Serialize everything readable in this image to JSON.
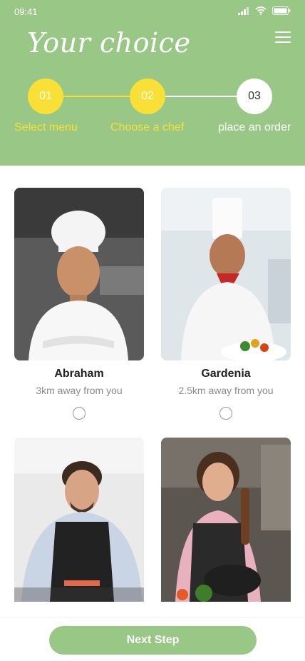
{
  "status_bar": {
    "time": "09:41",
    "icons": [
      "signal-icon",
      "wifi-icon",
      "battery-icon"
    ]
  },
  "header": {
    "title": "Your choice",
    "menu_icon": "hamburger-menu-icon"
  },
  "steps": [
    {
      "number": "01",
      "label": "Select menu",
      "state": "done"
    },
    {
      "number": "02",
      "label": "Choose a chef",
      "state": "current"
    },
    {
      "number": "03",
      "label": "place an order",
      "state": "pending"
    }
  ],
  "chefs": [
    {
      "name": "Abraham",
      "distance": "3km away from you",
      "selected": false
    },
    {
      "name": "Gardenia",
      "distance": "2.5km away from you",
      "selected": false
    },
    {
      "name": "",
      "distance": "",
      "selected": false
    },
    {
      "name": "",
      "distance": "",
      "selected": false
    }
  ],
  "footer": {
    "next_label": "Next Step"
  },
  "colors": {
    "primary_green": "#98c786",
    "accent_yellow": "#f8e036",
    "text_dark": "#222222",
    "text_muted": "#8a8a8a"
  }
}
